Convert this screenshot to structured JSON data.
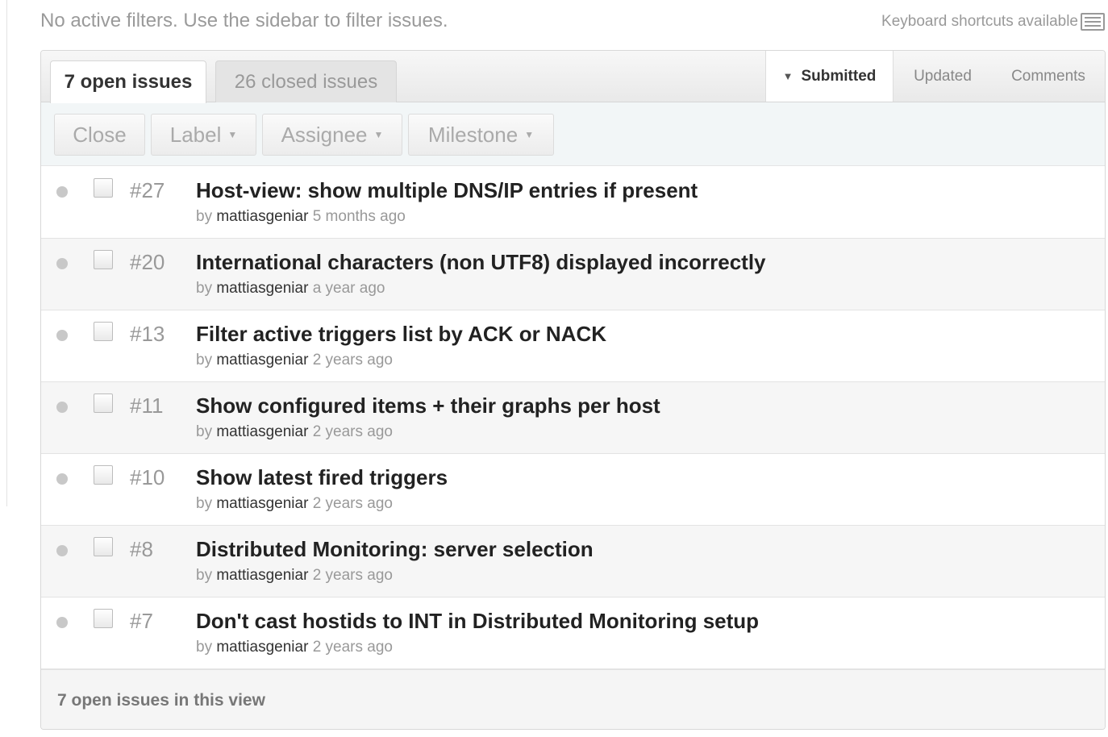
{
  "filter_note": "No active filters. Use the sidebar to filter issues.",
  "keyboard_note": "Keyboard shortcuts available",
  "tabs": [
    {
      "label": "7 open issues",
      "active": true
    },
    {
      "label": "26 closed issues",
      "active": false
    }
  ],
  "sort": {
    "options": [
      "Submitted",
      "Updated",
      "Comments"
    ],
    "selected": "Submitted"
  },
  "actions": {
    "close": "Close",
    "label": "Label",
    "assignee": "Assignee",
    "milestone": "Milestone"
  },
  "issues": [
    {
      "number": "#27",
      "title": "Host-view: show multiple DNS/IP entries if present",
      "by": "by",
      "author": "mattiasgeniar",
      "when": "5 months ago"
    },
    {
      "number": "#20",
      "title": "International characters (non UTF8) displayed incorrectly",
      "by": "by",
      "author": "mattiasgeniar",
      "when": "a year ago"
    },
    {
      "number": "#13",
      "title": "Filter active triggers list by ACK or NACK",
      "by": "by",
      "author": "mattiasgeniar",
      "when": "2 years ago"
    },
    {
      "number": "#11",
      "title": "Show configured items + their graphs per host",
      "by": "by",
      "author": "mattiasgeniar",
      "when": "2 years ago"
    },
    {
      "number": "#10",
      "title": "Show latest fired triggers",
      "by": "by",
      "author": "mattiasgeniar",
      "when": "2 years ago"
    },
    {
      "number": "#8",
      "title": "Distributed Monitoring: server selection",
      "by": "by",
      "author": "mattiasgeniar",
      "when": "2 years ago"
    },
    {
      "number": "#7",
      "title": "Don't cast hostids to INT in Distributed Monitoring setup",
      "by": "by",
      "author": "mattiasgeniar",
      "when": "2 years ago"
    }
  ],
  "footer": "7 open issues in this view",
  "colors": {
    "toolbar_bg": "#f2f6f7",
    "status_dot": "#c8c8c8",
    "title_text": "#222222"
  }
}
